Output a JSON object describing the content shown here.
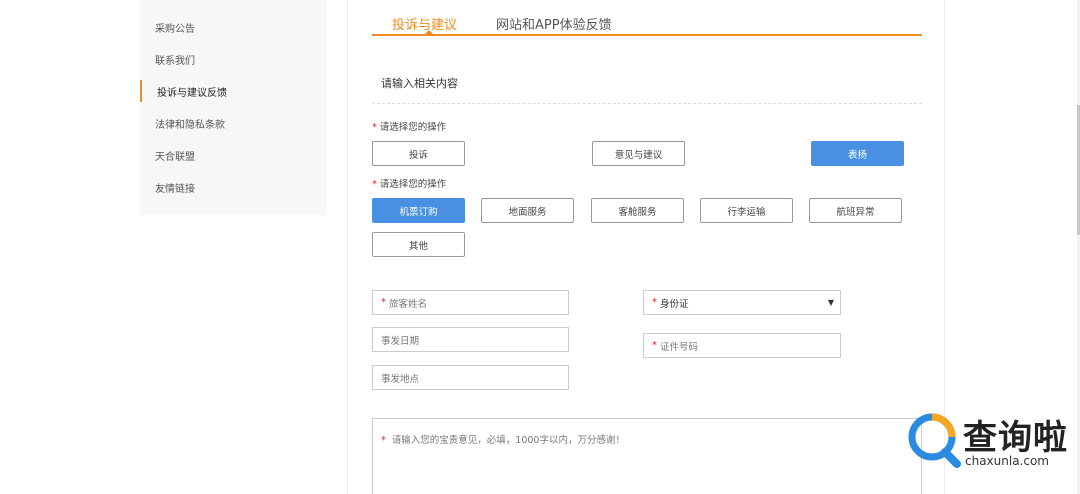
{
  "sidebar": {
    "items": [
      {
        "label": "采购公告"
      },
      {
        "label": "联系我们"
      },
      {
        "label": "投诉与建议反馈"
      },
      {
        "label": "法律和隐私条款"
      },
      {
        "label": "天合联盟"
      },
      {
        "label": "友情链接"
      }
    ],
    "active_index": 2
  },
  "tabs": [
    {
      "label": "投诉与建议",
      "active": true
    },
    {
      "label": "网站和APP体验反馈",
      "active": false
    }
  ],
  "form": {
    "section_title": "请输入相关内容",
    "required_mark": "*",
    "group1": {
      "label": "请选择您的操作",
      "options": [
        "投诉",
        "意见与建议",
        "表扬"
      ],
      "selected": "表扬"
    },
    "group2": {
      "label": "请选择您的操作",
      "options": [
        "机票订购",
        "地面服务",
        "客舱服务",
        "行李运输",
        "航班异常",
        "其他"
      ],
      "selected": "机票订购"
    },
    "passenger_name": {
      "placeholder": "旅客姓名"
    },
    "id_type": {
      "value": "身份证",
      "arrow": "▼"
    },
    "incident_date": {
      "placeholder": "事发日期"
    },
    "id_number": {
      "placeholder": "证件号码"
    },
    "incident_location": {
      "placeholder": "事发地点"
    },
    "comment": {
      "placeholder": "请输入您的宝贵意见，必填，1000字以内，万分感谢！"
    }
  },
  "watermark": {
    "text": "查询啦",
    "url": "chaxunla.com"
  },
  "colors": {
    "accent": "#f08a24",
    "primary_button": "#4a90e2",
    "required": "#e02020"
  }
}
